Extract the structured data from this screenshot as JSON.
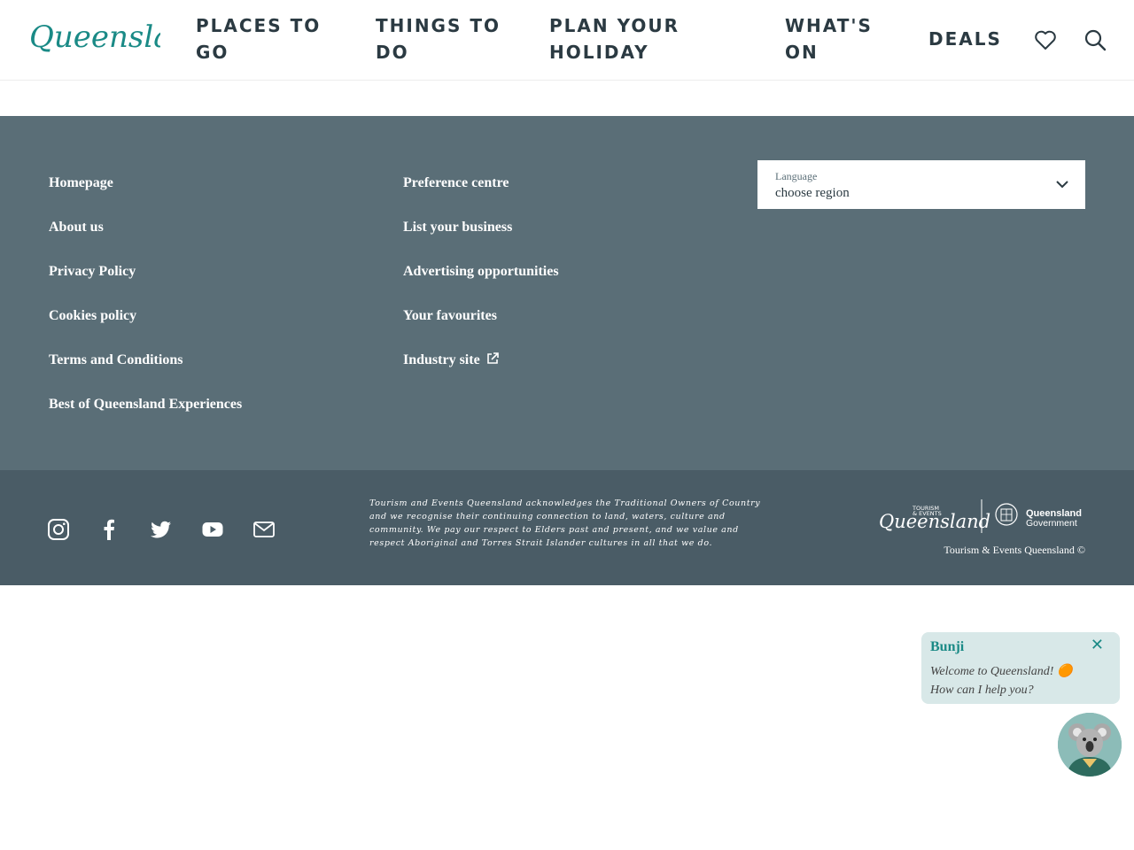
{
  "header": {
    "logo_text": "Queensland",
    "nav": [
      {
        "label": "PLACES TO\nGO"
      },
      {
        "label": "THINGS TO\nDO"
      },
      {
        "label": "PLAN YOUR\nHOLIDAY"
      },
      {
        "label": "WHAT'S\nON"
      },
      {
        "label": "DEALS"
      }
    ],
    "icons": [
      "heart-icon",
      "search-icon"
    ]
  },
  "footer": {
    "links_col1": [
      "Homepage",
      "About us",
      "Privacy Policy",
      "Cookies policy",
      "Terms and Conditions",
      "Best of Queensland Experiences"
    ],
    "links_col2": [
      "Preference centre",
      "List your business",
      "Advertising opportunities",
      "Your favourites",
      "Industry site"
    ],
    "language": {
      "label": "Language",
      "value": "choose region"
    },
    "social": [
      "instagram-icon",
      "facebook-icon",
      "twitter-icon",
      "youtube-icon",
      "email-icon"
    ],
    "acknowledgement": "Tourism and Events Queensland acknowledges the Traditional Owners of Country and we recognise their continuing connection to land, waters, culture and community. We pay our respect to Elders past and present, and we value and respect Aboriginal and Torres Strait Islander cultures in all that we do.",
    "partner_logo": {
      "tag_line1": "TOURISM",
      "tag_line2": "& EVENTS",
      "brand": "Queensland",
      "gov_line1": "Queensland",
      "gov_line2": "Government"
    },
    "copyright": "Tourism & Events Queensland ©"
  },
  "chat": {
    "name": "Bunji",
    "message": "Welcome to Queensland! 🟠\nHow can I help you?"
  },
  "colors": {
    "brand_teal": "#1a8a86",
    "footer_top": "#5a6e77",
    "footer_bottom": "#4a5c66",
    "nav_text": "#2b3a42"
  }
}
